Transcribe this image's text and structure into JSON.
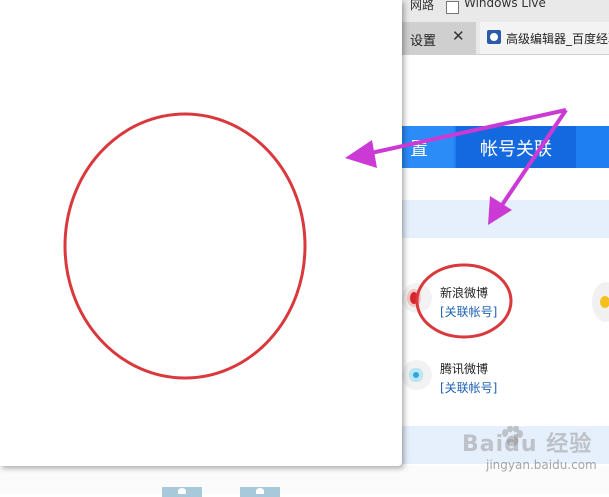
{
  "background_window": {
    "top_strip": {
      "left_text": "网路",
      "checkbox_label": "Windows Live"
    },
    "tabs": [
      {
        "label": "设置",
        "close": "✕"
      },
      {
        "label": "高级编辑器_百度经验"
      }
    ],
    "nav": {
      "partial_left": "置",
      "active": "帐号关联"
    },
    "accounts": [
      {
        "name": "新浪微博",
        "link": "[关联帐号]"
      },
      {
        "name": "腾讯微博",
        "link": "[关联帐号]"
      }
    ]
  },
  "annotations": {
    "circle_color": "#d9393d",
    "arrow_color": "#cc3ad6"
  },
  "watermark": {
    "main": "Baidu 经验",
    "sub": "jingyan.baidu.com"
  }
}
